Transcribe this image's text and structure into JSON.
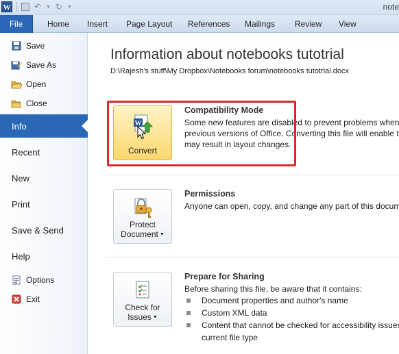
{
  "titlebar": {
    "app_icon": "word-icon",
    "app_letter": "W",
    "title": "note"
  },
  "tabs": {
    "file": "File",
    "items": [
      "Home",
      "Insert",
      "Page Layout",
      "References",
      "Mailings",
      "Review",
      "View"
    ]
  },
  "leftpane": {
    "save": "Save",
    "save_as": "Save As",
    "open": "Open",
    "close": "Close",
    "info": "Info",
    "recent": "Recent",
    "new": "New",
    "print": "Print",
    "save_send": "Save & Send",
    "help": "Help",
    "options": "Options",
    "exit": "Exit"
  },
  "info": {
    "title": "Information about notebooks tutotrial",
    "path": "D:\\Rajesh's stuff\\My Dropbox\\Notebooks forum\\notebooks tutotrial.docx"
  },
  "compat": {
    "button": "Convert",
    "heading": "Compatibility Mode",
    "line1": "Some new features are disabled to prevent problems when w",
    "line2": "previous versions of Office. Converting this file will enable t",
    "line3": "may result in layout changes."
  },
  "permissions": {
    "button_line1": "Protect",
    "button_line2": "Document",
    "heading": "Permissions",
    "text": "Anyone can open, copy, and change any part of this docum"
  },
  "sharing": {
    "button_line1": "Check for",
    "button_line2": "Issues",
    "heading": "Prepare for Sharing",
    "intro": "Before sharing this file, be aware that it contains:",
    "bullets": [
      "Document properties and author's name",
      "Custom XML data",
      "Content that cannot be checked for accessibility issues",
      "current file type"
    ]
  },
  "colors": {
    "file_tab": "#2a67b5",
    "highlight": "#fbd76d",
    "red_box": "#d42a2a"
  }
}
